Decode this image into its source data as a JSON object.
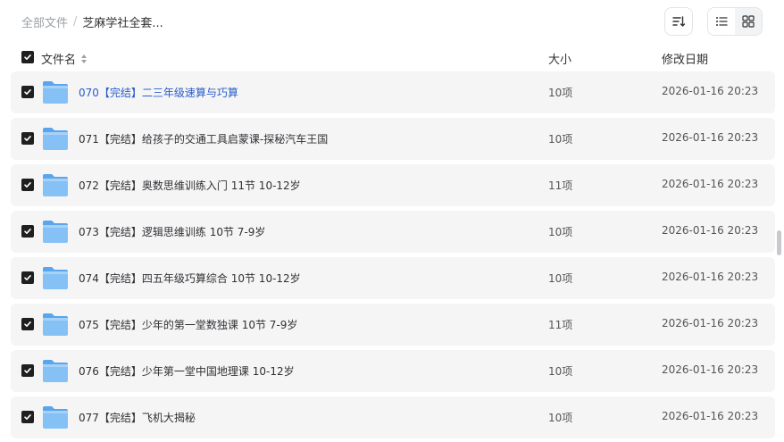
{
  "breadcrumb": {
    "root": "全部文件",
    "separator": "/",
    "current": "芝麻学社全套..."
  },
  "toolbar": {
    "sort_icon": "sort-icon",
    "list_icon": "list-view-icon",
    "grid_icon": "grid-view-icon"
  },
  "columns": {
    "name": "文件名",
    "size": "大小",
    "date": "修改日期"
  },
  "colors": {
    "accent_link": "#2a5ecb",
    "row_bg": "#f5f5f6",
    "folder": "#79b8f3"
  },
  "rows": [
    {
      "name": "070【完结】二三年级速算与巧算",
      "size": "10项",
      "date": "2026-01-16 20:23"
    },
    {
      "name": "071【完结】给孩子的交通工具启蒙课-探秘汽车王国",
      "size": "10项",
      "date": "2026-01-16 20:23"
    },
    {
      "name": "072【完结】奥数思维训练入门 11节 10-12岁",
      "size": "11项",
      "date": "2026-01-16 20:23"
    },
    {
      "name": "073【完结】逻辑思维训练 10节 7-9岁",
      "size": "10项",
      "date": "2026-01-16 20:23"
    },
    {
      "name": "074【完结】四五年级巧算综合 10节 10-12岁",
      "size": "10项",
      "date": "2026-01-16 20:23"
    },
    {
      "name": "075【完结】少年的第一堂数独课 10节 7-9岁",
      "size": "11项",
      "date": "2026-01-16 20:23"
    },
    {
      "name": "076【完结】少年第一堂中国地理课 10-12岁",
      "size": "10项",
      "date": "2026-01-16 20:23"
    },
    {
      "name": "077【完结】飞机大揭秘",
      "size": "10项",
      "date": "2026-01-16 20:23"
    }
  ]
}
